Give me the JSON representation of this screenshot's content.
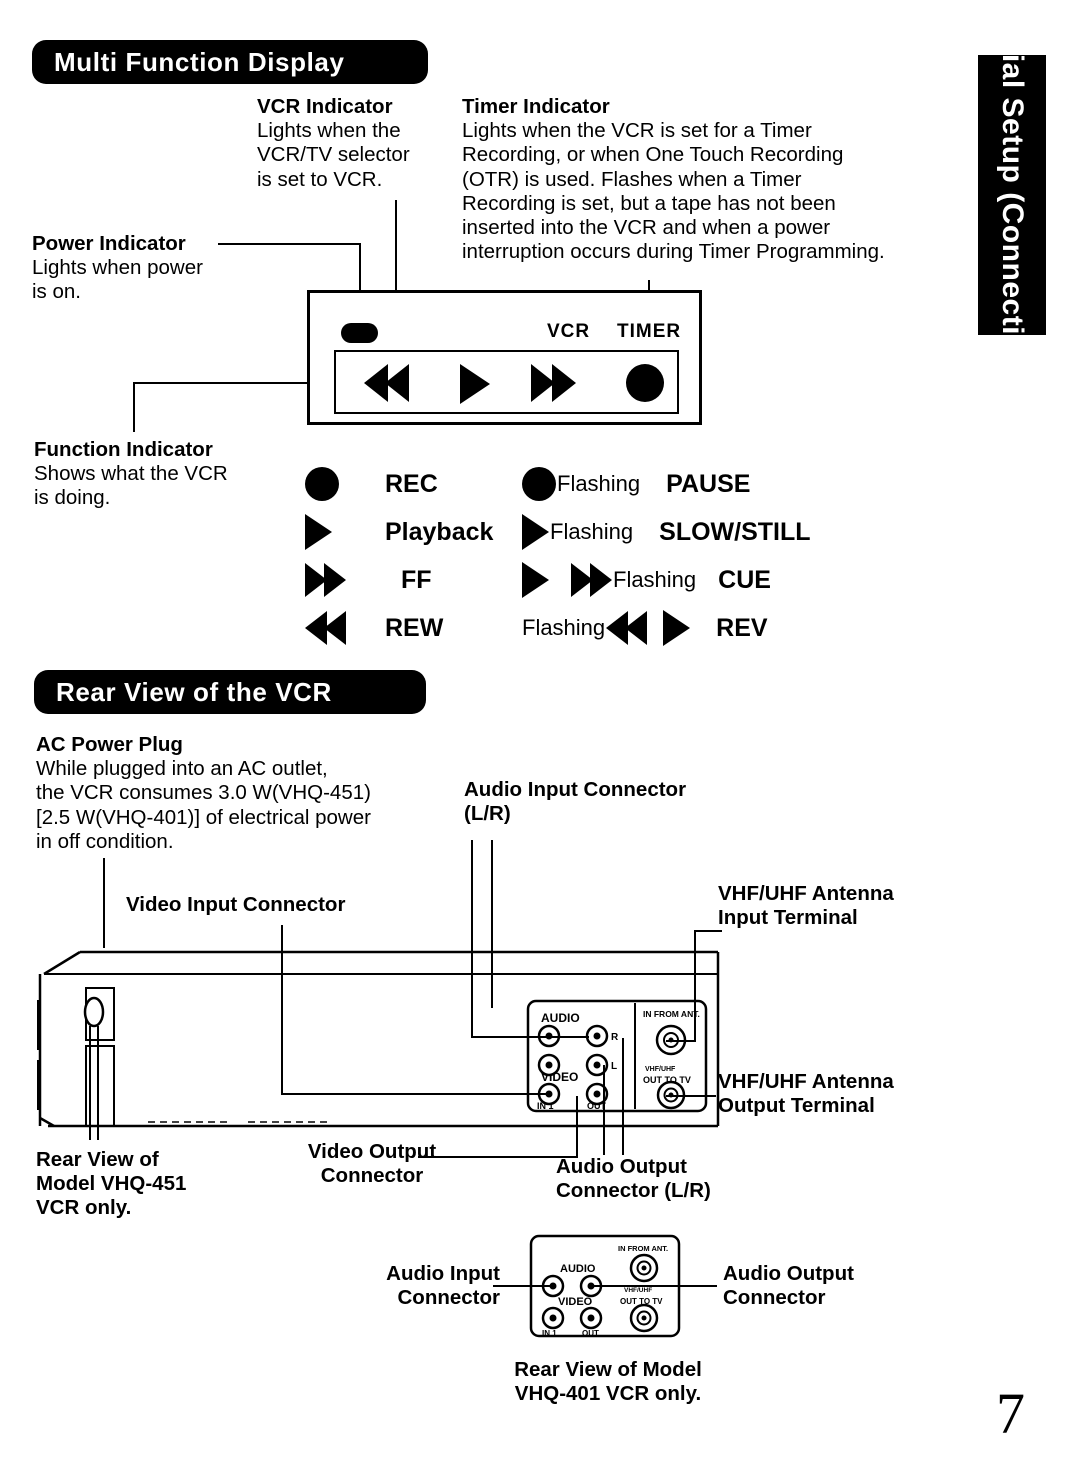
{
  "page": {
    "number": "7",
    "side_tab": "Initial Setup (Connection)"
  },
  "sections": {
    "display": {
      "title": "Multi Function Display"
    },
    "rear": {
      "title": "Rear View of the VCR"
    }
  },
  "callouts": {
    "vcr_indicator": {
      "title": "VCR Indicator",
      "body": "Lights when the VCR/TV selector is set to VCR.",
      "lines": [
        "Lights when the",
        "VCR/TV selector",
        "is set to VCR."
      ]
    },
    "timer_indicator": {
      "title": "Timer Indicator",
      "body": "Lights when the VCR is set for a Timer Recording, or when One  Touch Recording (OTR) is used. Flashes when a Timer Recording is set, but a tape has not been inserted into the VCR and when a power interruption occurs during Timer Programming.",
      "lines": [
        "Lights when the VCR is set for a Timer",
        "Recording, or when One  Touch Recording",
        "(OTR) is used. Flashes when a Timer",
        "Recording is set, but a tape has not been",
        "inserted into the VCR and when a power",
        "interruption occurs during Timer Programming."
      ]
    },
    "power_indicator": {
      "title": "Power Indicator",
      "lines": [
        "Lights when power",
        "is on."
      ]
    },
    "function_indicator": {
      "title": "Function Indicator",
      "lines": [
        "Shows what the VCR",
        "is doing."
      ]
    },
    "ac_power_plug": {
      "title": "AC Power Plug",
      "lines": [
        "While plugged into an AC outlet,",
        "the VCR consumes 3.0 W(VHQ-451)",
        "[2.5 W(VHQ-401)] of electrical  power",
        "in off condition."
      ]
    },
    "audio_input_451": {
      "lines": [
        "Audio Input Connector",
        "(L/R)"
      ]
    },
    "video_input_451": {
      "lines": [
        "Video Input Connector"
      ]
    },
    "antenna_input": {
      "lines": [
        "VHF/UHF Antenna",
        "Input Terminal"
      ]
    },
    "antenna_output": {
      "lines": [
        "VHF/UHF Antenna",
        "Output Terminal"
      ]
    },
    "video_output_451": {
      "lines": [
        "Video Output",
        "Connector"
      ]
    },
    "audio_output_451": {
      "lines": [
        "Audio Output",
        "Connector (L/R)"
      ]
    },
    "rear_view_451": {
      "lines": [
        "Rear View of",
        "Model VHQ-451",
        "VCR only."
      ]
    },
    "audio_input_401": {
      "lines": [
        "Audio Input",
        "Connector"
      ]
    },
    "audio_output_401": {
      "lines": [
        "Audio Output",
        "Connector"
      ]
    },
    "rear_view_401": {
      "lines": [
        "Rear View of Model",
        "VHQ-401 VCR only."
      ]
    }
  },
  "display_panel": {
    "power_led_name": "power-led",
    "vcr_label": "VCR",
    "timer_label": "TIMER",
    "icons": [
      "rewind",
      "play",
      "fast-forward",
      "record"
    ]
  },
  "legend": {
    "left": [
      {
        "icon": "record-circle",
        "label": "REC"
      },
      {
        "icon": "play-triangle",
        "label": "Playback"
      },
      {
        "icon": "fast-forward-double",
        "label": "FF"
      },
      {
        "icon": "rewind-double",
        "label": "REW"
      }
    ],
    "right": [
      {
        "icon": "record-circle",
        "flash_before": "",
        "flash_after": "Flashing",
        "label": "PAUSE"
      },
      {
        "icon": "play-triangle",
        "flash_before": "",
        "flash_after": "Flashing",
        "label": "SLOW/STILL"
      },
      {
        "icon": "play-plus-ff",
        "flash_before": "",
        "flash_after": "Flashing",
        "label": "CUE"
      },
      {
        "icon": "rew-plus-play",
        "flash_before": "Flashing",
        "flash_after": "",
        "label": "REV"
      }
    ]
  },
  "rear_panel_451": {
    "audio_label": "AUDIO",
    "video_label": "VIDEO",
    "jack_r": "R",
    "jack_l": "L",
    "in1_label": "IN 1",
    "out_label": "OUT",
    "ant_in_label": "IN FROM ANT.",
    "vhf_uhf_label": "VHF/UHF",
    "out_to_tv_label": "OUT TO TV"
  },
  "rear_panel_401": {
    "audio_label": "AUDIO",
    "video_label": "VIDEO",
    "in1_label": "IN 1",
    "out_label": "OUT",
    "ant_in_label": "IN FROM ANT.",
    "vhf_uhf_label": "VHF/UHF",
    "out_to_tv_label": "OUT TO TV"
  },
  "colors": {
    "ink": "#000000",
    "paper": "#ffffff"
  }
}
